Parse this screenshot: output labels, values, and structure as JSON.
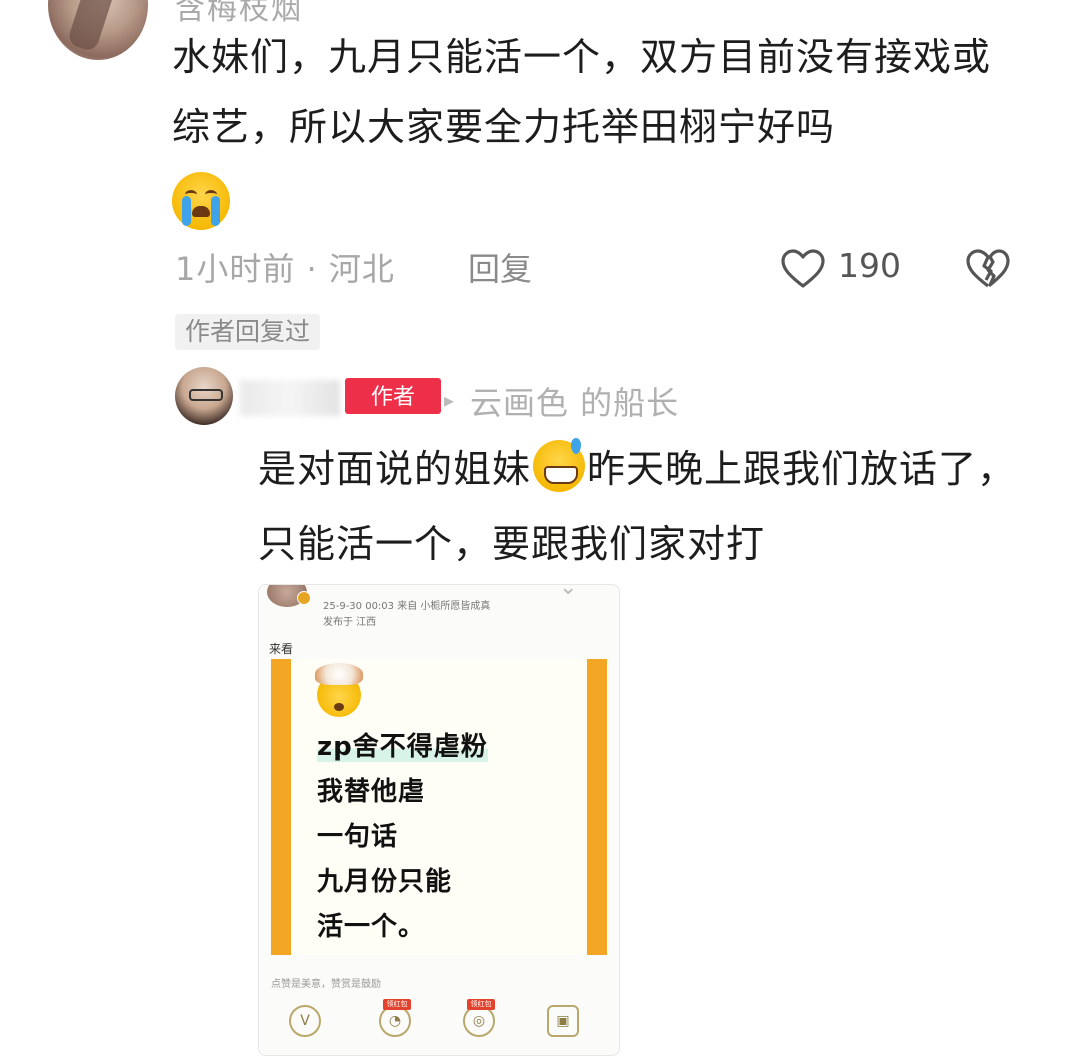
{
  "comment": {
    "username": "含梅枝烟",
    "text": "水妹们，九月只能活一个，双方目前没有接戏或综艺，所以大家要全力托举田栩宁好吗",
    "emoji": "loudly-crying-face",
    "time": "1小时前",
    "location": "河北",
    "meta": "1小时前 · 河北",
    "reply_label": "回复",
    "likes": "190",
    "author_replied_label": "作者回复过"
  },
  "reply": {
    "author_tag": "作者",
    "arrow": "▸",
    "target_name": "云画色 的船长",
    "text_part1": "是对面说的姐妹",
    "emoji": "grinning-face-with-sweat",
    "text_part2": "昨天晚上跟我们放话了，只能活一个，要跟我们家对打"
  },
  "embedded_post": {
    "date_line": "25-9-30 00:03  来自 小栀所愿皆成真",
    "location_line": "发布于 江西",
    "caption": "来看",
    "poster_lines": [
      "zp舍不得虐粉",
      "我替他虐",
      "一句话",
      "九月份只能",
      "活一个。"
    ],
    "footer": "点赞是美意，赞赏是鼓励",
    "badges": [
      "领红包",
      "领红包"
    ],
    "accent_color": "#f2a623"
  },
  "colors": {
    "author_tag_bg": "#ee2f4a",
    "meta_text": "#a7a7a7"
  }
}
